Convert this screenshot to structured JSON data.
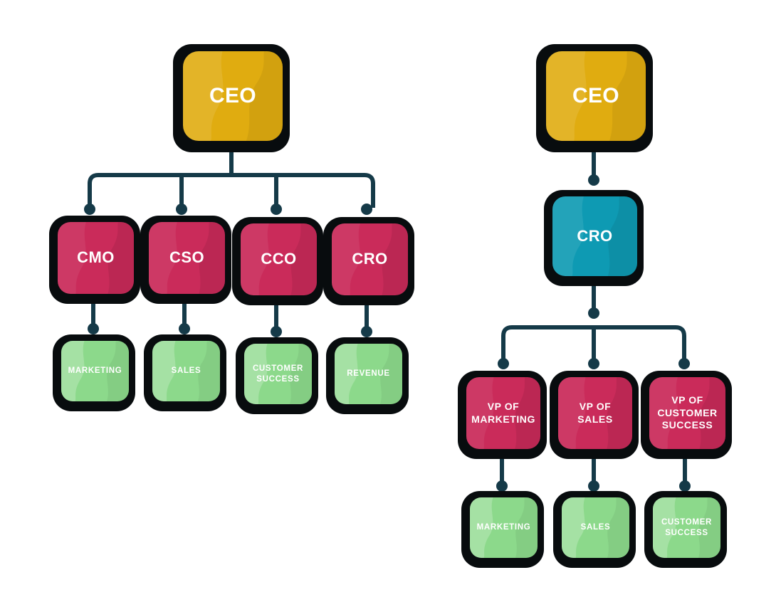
{
  "diagram": {
    "title_left": "",
    "title_right": "",
    "type": "org-chart",
    "background": "#FFFFFF",
    "palette": {
      "gold": "#E0AC10",
      "crimson": "#CA2B5A",
      "teal": "#0E9AB3",
      "green": "#8CD98B",
      "frame": "#080C0E",
      "connector": "#153A48",
      "text": "#FFFFFF"
    },
    "left_tree": {
      "root": {
        "label": "CEO",
        "color": "gold"
      },
      "level2": [
        {
          "label": "CMO",
          "color": "crimson"
        },
        {
          "label": "CSO",
          "color": "crimson"
        },
        {
          "label": "CCO",
          "color": "crimson"
        },
        {
          "label": "CRO",
          "color": "crimson"
        }
      ],
      "level3": [
        {
          "label": "MARKETING",
          "color": "green"
        },
        {
          "label": "SALES",
          "color": "green"
        },
        {
          "label": "CUSTOMER\nSUCCESS",
          "color": "green"
        },
        {
          "label": "REVENUE",
          "color": "green"
        }
      ]
    },
    "right_tree": {
      "root": {
        "label": "CEO",
        "color": "gold"
      },
      "level2": [
        {
          "label": "CRO",
          "color": "teal"
        }
      ],
      "level3": [
        {
          "label": "VP OF\nMARKETING",
          "color": "crimson"
        },
        {
          "label": "VP OF\nSALES",
          "color": "crimson"
        },
        {
          "label": "VP OF\nCUSTOMER\nSUCCESS",
          "color": "crimson"
        }
      ],
      "level4": [
        {
          "label": "MARKETING",
          "color": "green"
        },
        {
          "label": "SALES",
          "color": "green"
        },
        {
          "label": "CUSTOMER\nSUCCESS",
          "color": "green"
        }
      ]
    }
  }
}
